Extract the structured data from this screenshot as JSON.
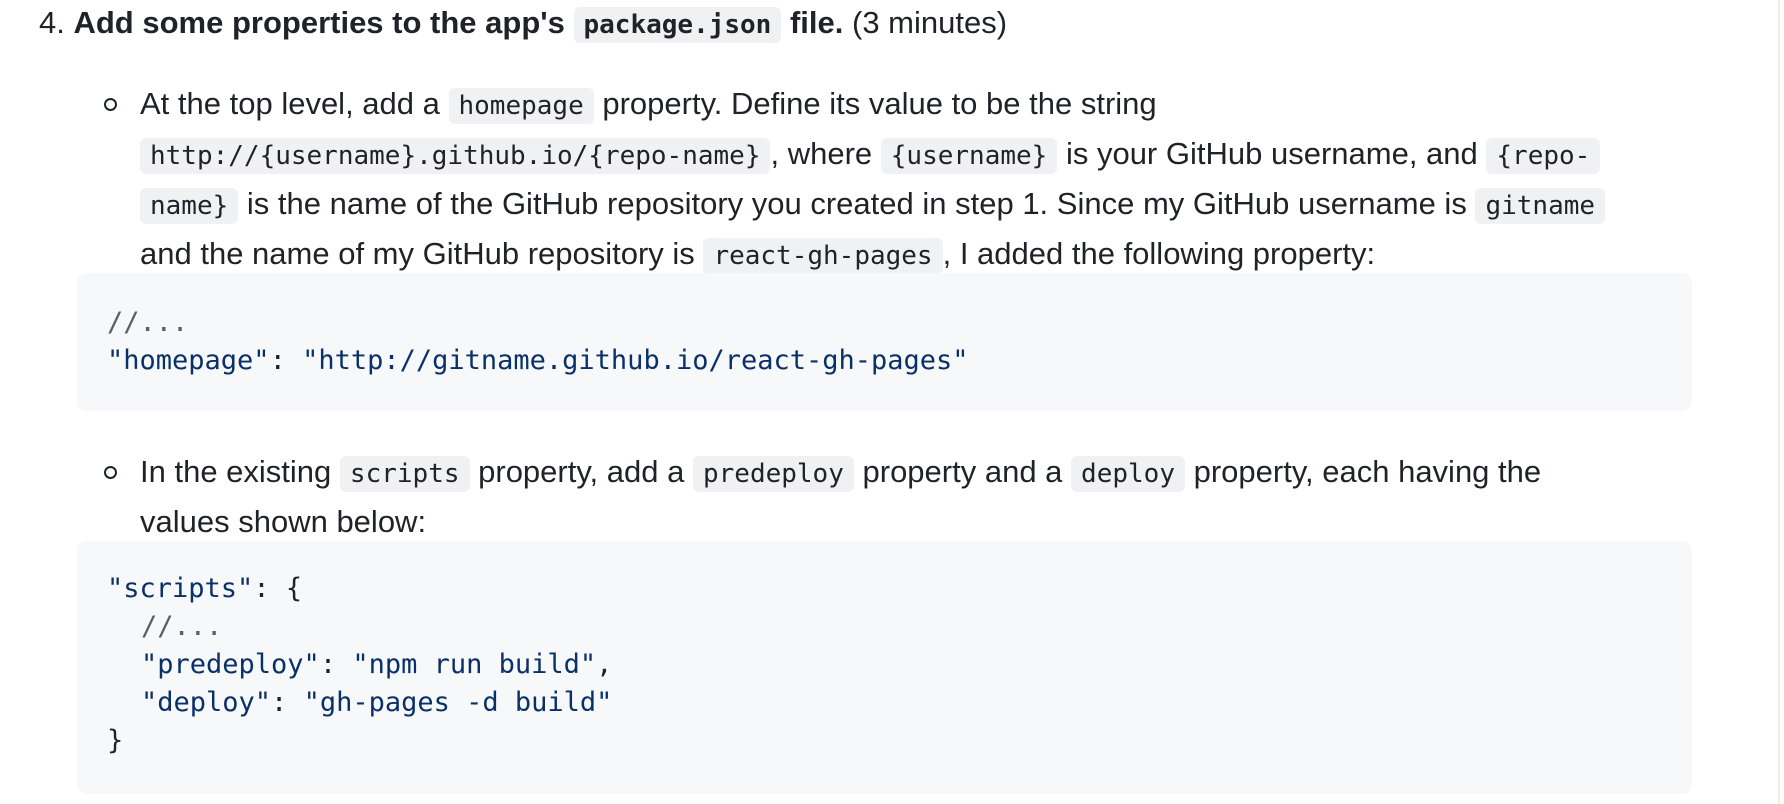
{
  "step": {
    "number": "4.",
    "text_before": "Add some properties to the app's",
    "code": "package.json",
    "text_after": "file.",
    "time": "(3 minutes)"
  },
  "bullet1": {
    "l1_a": "At the top level, add a",
    "l1_code": "homepage",
    "l1_b": "property. Define its value to be the string",
    "l2_code1": "http://{username}.github.io/{repo-name}",
    "l2_a": ", where",
    "l2_code2": "{username}",
    "l2_b": "is your GitHub username, and",
    "l2_code3": "{repo-",
    "l3_code1": "name}",
    "l3_a": "is the name of the GitHub repository you created in step 1. Since my GitHub username is",
    "l3_code2": "gitname",
    "l4_a": "and the name of my GitHub repository is",
    "l4_code": "react-gh-pages",
    "l4_b": ", I added the following property:"
  },
  "codeblock1": {
    "line1": "//...",
    "line2_key": "\"homepage\"",
    "line2_sep": ": ",
    "line2_val": "\"http://gitname.github.io/react-gh-pages\""
  },
  "bullet2": {
    "l1_a": "In the existing",
    "l1_code1": "scripts",
    "l1_b": "property, add a",
    "l1_code2": "predeploy",
    "l1_c": "property and a",
    "l1_code3": "deploy",
    "l1_d": "property, each having the",
    "l2": "values shown below:"
  },
  "codeblock2": {
    "line1_key": "\"scripts\"",
    "line1_rest": ": {",
    "line2": "//...",
    "line3_key": "\"predeploy\"",
    "line3_sep": ": ",
    "line3_val": "\"npm run build\"",
    "line3_end": ",",
    "line4_key": "\"deploy\"",
    "line4_sep": ": ",
    "line4_val": "\"gh-pages -d build\"",
    "line5": "}"
  }
}
